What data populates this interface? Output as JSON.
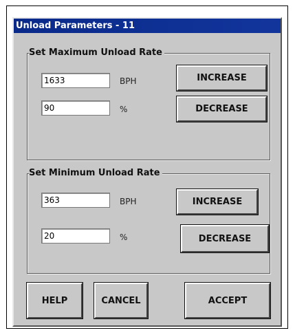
{
  "window": {
    "title": "Unload Parameters - 11"
  },
  "max_group": {
    "label": "Set Maximum Unload Rate",
    "bph_value": "1633",
    "bph_unit": "BPH",
    "percent_value": "90",
    "percent_unit": "%",
    "increase_label": "INCREASE",
    "decrease_label": "DECREASE"
  },
  "min_group": {
    "label": "Set Minimum Unload Rate",
    "bph_value": "363",
    "bph_unit": "BPH",
    "percent_value": "20",
    "percent_unit": "%",
    "increase_label": "INCREASE",
    "decrease_label": "DECREASE"
  },
  "footer": {
    "help_label": "HELP",
    "cancel_label": "CANCEL",
    "accept_label": "ACCEPT"
  }
}
